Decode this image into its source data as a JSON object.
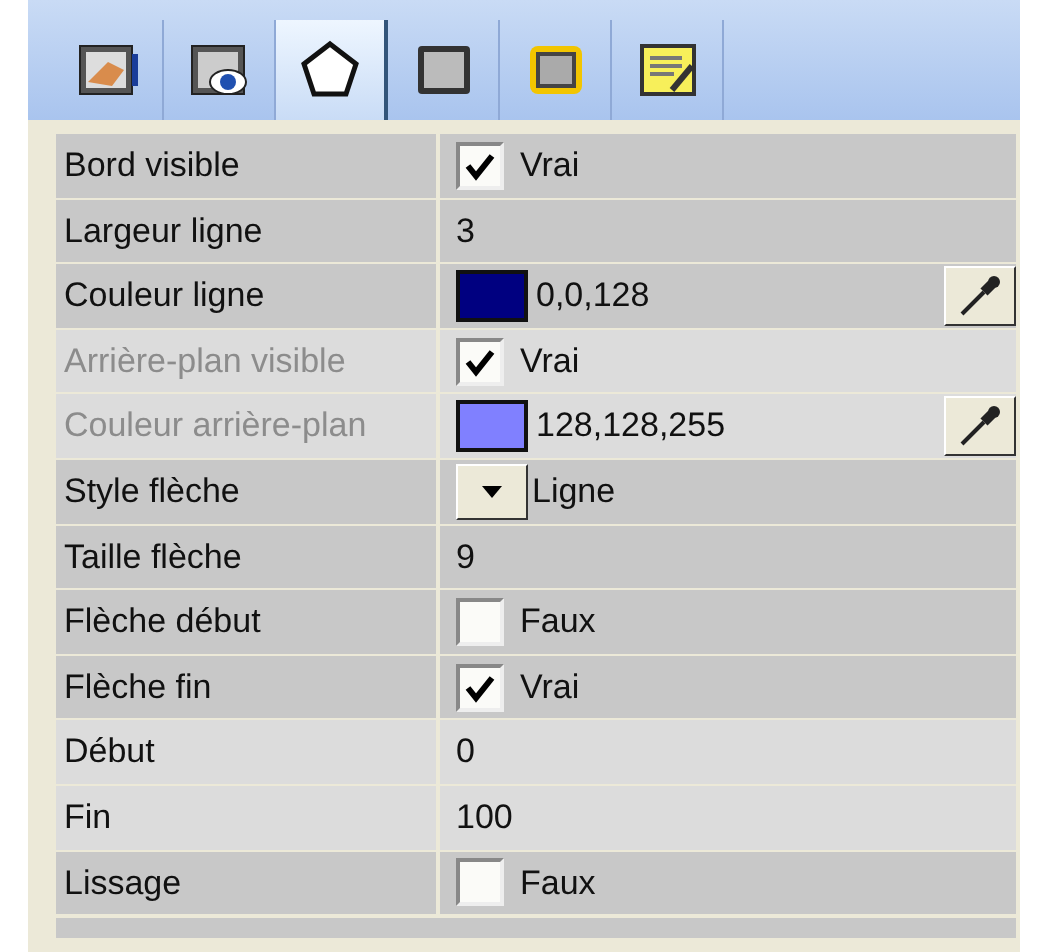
{
  "tabs": [
    {
      "selected": false
    },
    {
      "selected": false
    },
    {
      "selected": true
    },
    {
      "selected": false
    },
    {
      "selected": false
    },
    {
      "selected": false
    }
  ],
  "properties": [
    {
      "label": "Bord visible",
      "kind": "checkbox",
      "checked": true,
      "value": "Vrai",
      "disabled": false,
      "shaded": true
    },
    {
      "label": "Largeur ligne",
      "kind": "text",
      "value": "3",
      "disabled": false,
      "shaded": true
    },
    {
      "label": "Couleur ligne",
      "kind": "color",
      "color": "#000080",
      "value": "0,0,128",
      "disabled": false,
      "shaded": true
    },
    {
      "label": "Arrière-plan visible",
      "kind": "checkbox",
      "checked": true,
      "value": "Vrai",
      "disabled": true,
      "shaded": false
    },
    {
      "label": "Couleur arrière-plan",
      "kind": "color",
      "color": "#8080ff",
      "value": "128,128,255",
      "disabled": true,
      "shaded": false
    },
    {
      "label": "Style flèche",
      "kind": "dropdown",
      "value": "Ligne",
      "disabled": false,
      "shaded": true
    },
    {
      "label": "Taille flèche",
      "kind": "text",
      "value": "9",
      "disabled": false,
      "shaded": true
    },
    {
      "label": "Flèche début",
      "kind": "checkbox",
      "checked": false,
      "value": "Faux",
      "disabled": false,
      "shaded": true
    },
    {
      "label": "Flèche fin",
      "kind": "checkbox",
      "checked": true,
      "value": "Vrai",
      "disabled": false,
      "shaded": true
    },
    {
      "label": "Début",
      "kind": "text",
      "value": "0",
      "disabled": false,
      "shaded": false
    },
    {
      "label": "Fin",
      "kind": "text",
      "value": "100",
      "disabled": false,
      "shaded": false
    },
    {
      "label": "Lissage",
      "kind": "checkbox",
      "checked": false,
      "value": "Faux",
      "disabled": false,
      "shaded": true
    }
  ]
}
